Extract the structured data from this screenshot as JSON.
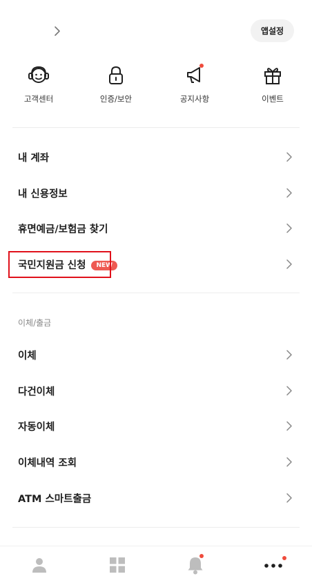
{
  "header": {
    "app_settings_label": "앱설정"
  },
  "quick_menu": [
    {
      "label": "고객센터",
      "icon": "headset-icon"
    },
    {
      "label": "인증/보안",
      "icon": "lock-icon"
    },
    {
      "label": "공지사항",
      "icon": "megaphone-icon",
      "has_dot": true
    },
    {
      "label": "이벤트",
      "icon": "gift-icon"
    }
  ],
  "account_menu": [
    {
      "label": "내 계좌"
    },
    {
      "label": "내 신용정보"
    },
    {
      "label": "휴면예금/보험금 찾기"
    },
    {
      "label": "국민지원금 신청",
      "badge": "NEW"
    }
  ],
  "transfer_section": {
    "title": "이체/출금",
    "items": [
      {
        "label": "이체"
      },
      {
        "label": "다건이체"
      },
      {
        "label": "자동이체"
      },
      {
        "label": "이체내역 조회"
      },
      {
        "label": "ATM 스마트출금"
      }
    ]
  },
  "bottom_nav": [
    {
      "icon": "person-icon"
    },
    {
      "icon": "grid-icon"
    },
    {
      "icon": "bell-icon",
      "has_dot": true
    },
    {
      "icon": "more-icon",
      "has_dot": true,
      "active": true
    }
  ],
  "colors": {
    "accent_dot": "#ef4b3c",
    "highlight_border": "#e0101a",
    "new_badge": "#ee5a52"
  }
}
